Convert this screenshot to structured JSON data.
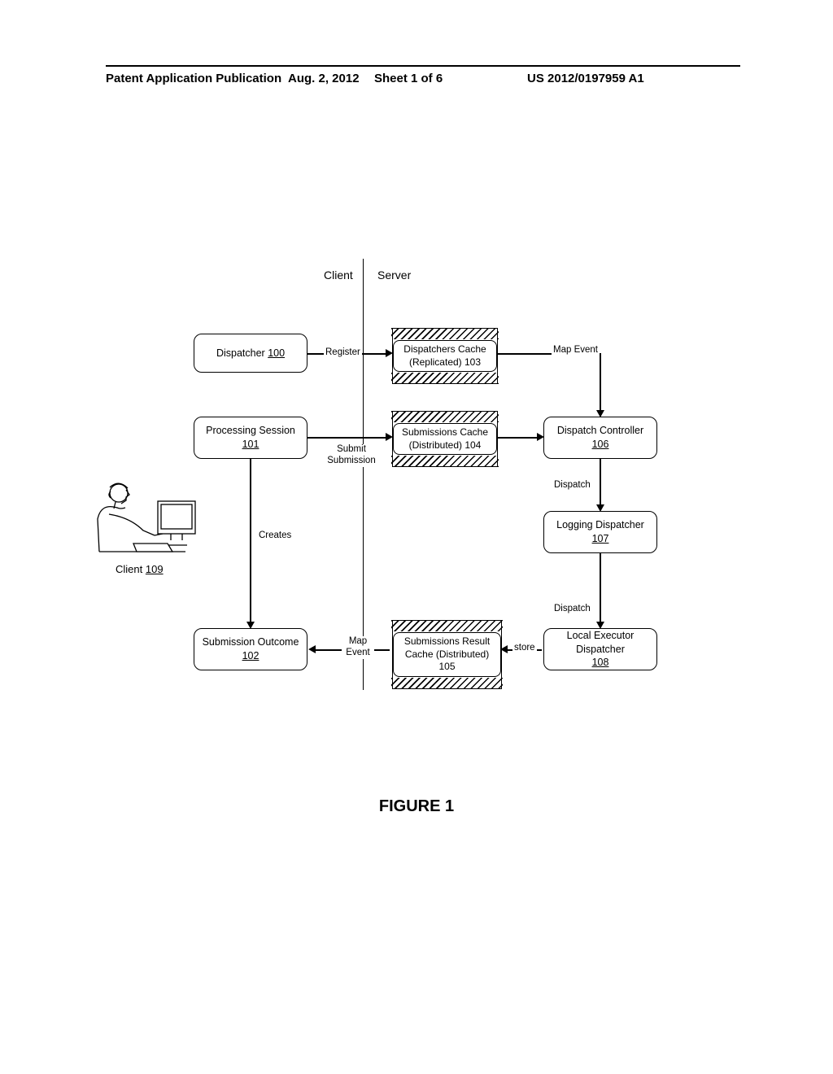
{
  "header": {
    "publication_type": "Patent Application Publication",
    "date": "Aug. 2, 2012",
    "sheet": "Sheet 1 of 6",
    "pub_number": "US 2012/0197959 A1"
  },
  "diagram": {
    "columns": {
      "client": "Client",
      "server": "Server"
    },
    "nodes": {
      "dispatcher": {
        "label": "Dispatcher",
        "ref": "100"
      },
      "processing_session": {
        "label": "Processing Session",
        "ref": "101"
      },
      "submission_outcome": {
        "label": "Submission Outcome",
        "ref": "102"
      },
      "dispatchers_cache": {
        "label": "Dispatchers Cache (Replicated)",
        "ref": "103"
      },
      "submissions_cache": {
        "label": "Submissions Cache (Distributed)",
        "ref": "104"
      },
      "results_cache": {
        "label": "Submissions Result Cache (Distributed)",
        "ref": "105"
      },
      "dispatch_controller": {
        "label": "Dispatch Controller",
        "ref": "106"
      },
      "logging_dispatcher": {
        "label": "Logging Dispatcher",
        "ref": "107"
      },
      "local_executor": {
        "label": "Local Executor Dispatcher",
        "ref": "108"
      },
      "client": {
        "label": "Client",
        "ref": "109"
      }
    },
    "edges": {
      "register": "Register",
      "submit": "Submit Submission",
      "creates": "Creates",
      "map_event_top": "Map Event",
      "map_event_bottom": "Map Event",
      "dispatch1": "Dispatch",
      "dispatch2": "Dispatch",
      "store": "store"
    }
  },
  "caption": "FIGURE 1"
}
